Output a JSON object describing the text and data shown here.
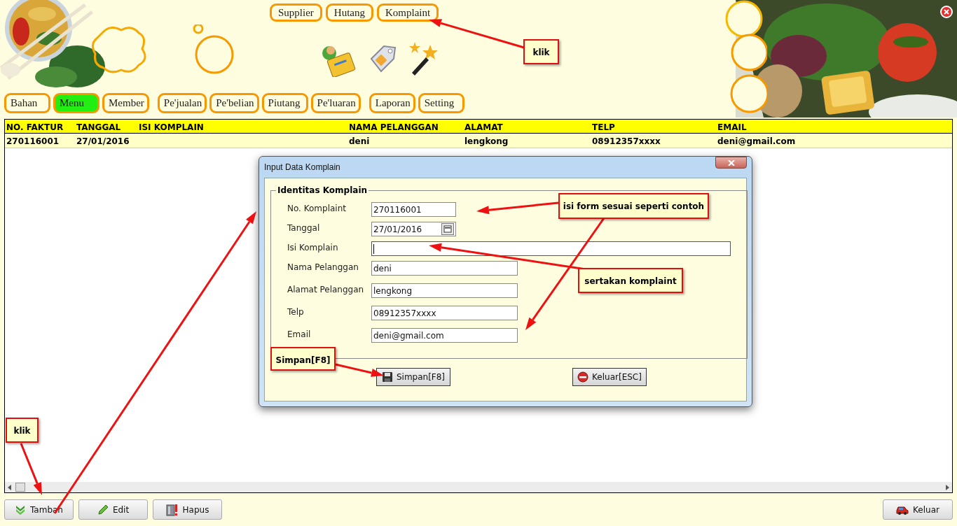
{
  "top_tabs": [
    {
      "label": "Supplier"
    },
    {
      "label": "Hutang"
    },
    {
      "label": "Komplaint"
    }
  ],
  "nav_groups": [
    [
      {
        "label": "Bahan",
        "selected": false
      },
      {
        "label": "Menu",
        "selected": true
      },
      {
        "label": "Member",
        "selected": false
      }
    ],
    [
      {
        "label": "Pe'jualan",
        "selected": false
      },
      {
        "label": "Pe'belian",
        "selected": false
      },
      {
        "label": "Piutang",
        "selected": false
      },
      {
        "label": "Pe'luaran",
        "selected": false
      }
    ],
    [
      {
        "label": "Laporan",
        "selected": false
      },
      {
        "label": "Setting",
        "selected": false
      }
    ]
  ],
  "table": {
    "columns": [
      "NO. FAKTUR",
      "TANGGAL",
      "ISI KOMPLAIN",
      "NAMA PELANGGAN",
      "ALAMAT",
      "TELP",
      "EMAIL"
    ],
    "rows": [
      [
        "270116001",
        "27/01/2016",
        null,
        "deni",
        "lengkong",
        "08912357xxxx",
        "deni@gmail.com"
      ]
    ]
  },
  "dialog": {
    "title": "Input Data Komplain",
    "group_title": "Identitas Komplain",
    "fields": [
      {
        "label": "No. Komplaint",
        "value": "270116001",
        "kind": "short",
        "focused": false
      },
      {
        "label": "Tanggal",
        "value": "27/01/2016",
        "kind": "date",
        "focused": false
      },
      {
        "label": "Isi Komplain",
        "kind": "long",
        "focused": true
      },
      {
        "label": "Nama Pelanggan",
        "value": "deni",
        "kind": "text",
        "focused": false
      },
      {
        "label": "Alamat Pelanggan",
        "value": "lengkong",
        "kind": "text",
        "focused": false
      },
      {
        "label": "Telp",
        "value": "08912357xxxx",
        "kind": "text",
        "focused": false
      },
      {
        "label": "Email",
        "value": "deni@gmail.com",
        "kind": "text",
        "focused": false
      }
    ],
    "buttons": [
      {
        "label": "Simpan[F8]",
        "kind": "save"
      },
      {
        "label": "Keluar[ESC]",
        "kind": "exit"
      }
    ]
  },
  "bottom_buttons": [
    {
      "label": "Tambah",
      "kind": "add"
    },
    {
      "label": "Edit",
      "kind": "edit"
    },
    {
      "label": "Hapus",
      "kind": "delete"
    },
    {
      "label": "Keluar",
      "kind": "quit"
    }
  ],
  "callouts": [
    {
      "text": "klik"
    },
    {
      "text": "isi form sesuai seperti contoh"
    },
    {
      "text": "sertakan komplaint"
    },
    {
      "text": "Simpan[F8]"
    },
    {
      "text": "klik"
    }
  ]
}
